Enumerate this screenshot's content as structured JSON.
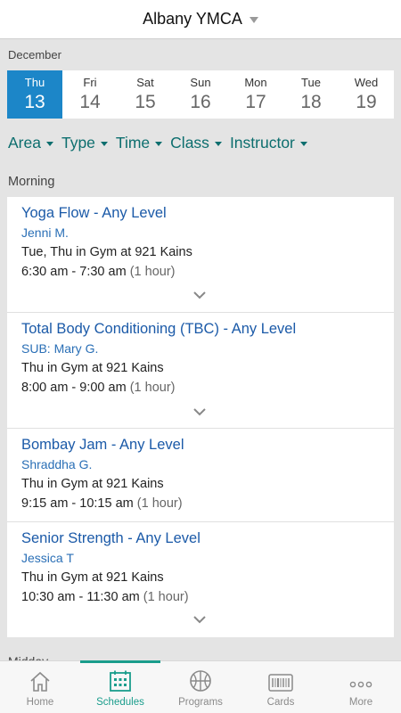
{
  "header": {
    "title": "Albany YMCA",
    "caret_icon": "chevron-down-icon"
  },
  "month": "December",
  "days": [
    {
      "dow": "Thu",
      "num": "13",
      "active": true
    },
    {
      "dow": "Fri",
      "num": "14"
    },
    {
      "dow": "Sat",
      "num": "15"
    },
    {
      "dow": "Sun",
      "num": "16"
    },
    {
      "dow": "Mon",
      "num": "17"
    },
    {
      "dow": "Tue",
      "num": "18"
    },
    {
      "dow": "Wed",
      "num": "19"
    }
  ],
  "filters": [
    "Area",
    "Type",
    "Time",
    "Class",
    "Instructor"
  ],
  "sections": {
    "morning": "Morning",
    "midday": "Midday"
  },
  "classes": [
    {
      "name": "Yoga Flow - Any Level",
      "instructor": "Jenni M.",
      "days": "Tue, Thu",
      "in": "in",
      "location": "Gym at 921 Kains",
      "time": "6:30 am - 7:30 am",
      "duration": "(1 hour)",
      "expand": true
    },
    {
      "name": "Total Body Conditioning (TBC) - Any Level",
      "instructor": "SUB: Mary G.",
      "days": "Thu",
      "in": "in",
      "location": "Gym at 921 Kains",
      "time": "8:00 am - 9:00 am",
      "duration": "(1 hour)",
      "expand": true
    },
    {
      "name": "Bombay Jam - Any Level",
      "instructor": "Shraddha G.",
      "days": "Thu",
      "in": "in",
      "location": "Gym at 921 Kains",
      "time": "9:15 am - 10:15 am",
      "duration": "(1 hour)",
      "expand": false
    },
    {
      "name": "Senior Strength - Any Level",
      "instructor": "Jessica T",
      "days": "Thu",
      "in": "in",
      "location": "Gym at 921 Kains",
      "time": "10:30 am - 11:30 am",
      "duration": "(1 hour)",
      "expand": true
    }
  ],
  "tabs": [
    {
      "label": "Home",
      "icon": "home-icon",
      "active": false
    },
    {
      "label": "Schedules",
      "icon": "calendar-icon",
      "active": true
    },
    {
      "label": "Programs",
      "icon": "basketball-icon",
      "active": false
    },
    {
      "label": "Cards",
      "icon": "barcode-card-icon",
      "active": false
    },
    {
      "label": "More",
      "icon": "more-dots-icon",
      "active": false
    }
  ],
  "colors": {
    "accent_blue": "#1c86c8",
    "teal": "#0c6e6e",
    "tab_active": "#1a9d8c",
    "link_blue": "#1b5aa8"
  }
}
